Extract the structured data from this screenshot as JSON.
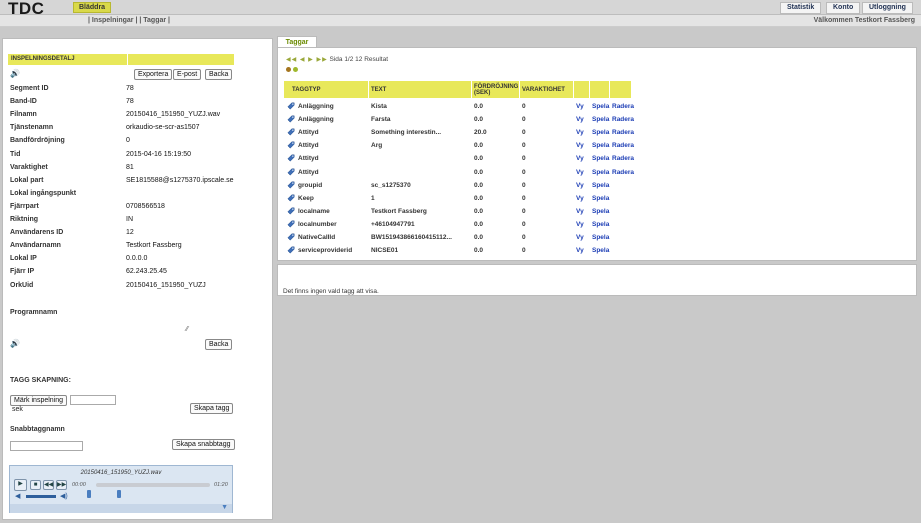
{
  "header": {
    "logo": "TDC",
    "active_nav": "Bläddra",
    "right_buttons": [
      "Statistik",
      "Konto",
      "Utloggning"
    ],
    "subnav": "| Inspelningar | | Taggar |",
    "welcome": "Välkommen Testkort Fassberg"
  },
  "detail": {
    "header": "INSPELNINGSDETALJ",
    "buttons": {
      "export": "Exportera",
      "email": "E-post",
      "back": "Backa"
    },
    "rows": [
      {
        "k": "Segment ID",
        "v": "78"
      },
      {
        "k": "Band-ID",
        "v": "78"
      },
      {
        "k": "Filnamn",
        "v": "20150416_151950_YUZJ.wav"
      },
      {
        "k": "Tjänstenamn",
        "v": "orkaudio-se-scr-as1507"
      },
      {
        "k": "Bandfördröjning",
        "v": "0"
      },
      {
        "k": "Tid",
        "v": "2015-04-16 15:19:50"
      },
      {
        "k": "Varaktighet",
        "v": "81"
      },
      {
        "k": "Lokal part",
        "v": "SE1815588@s1275370.ipscale.se"
      },
      {
        "k": "Lokal ingångspunkt",
        "v": ""
      },
      {
        "k": "Fjärrpart",
        "v": "0708566518"
      },
      {
        "k": "Riktning",
        "v": "IN"
      },
      {
        "k": "Användarens ID",
        "v": "12"
      },
      {
        "k": "Användarnamn",
        "v": "Testkort Fassberg"
      },
      {
        "k": "Lokal IP",
        "v": "0.0.0.0"
      },
      {
        "k": "Fjärr IP",
        "v": "62.243.25.45"
      },
      {
        "k": "OrkUid",
        "v": "20150416_151950_YUZJ"
      }
    ],
    "programnamn_label": "Programnamn",
    "back2": "Backa",
    "tag_creation_label": "TAGG SKAPNING:",
    "mark_btn": "Märk inspelning",
    "sek": "sek",
    "create_tag": "Skapa tagg",
    "quicktag_label": "Snabbtaggnamn",
    "create_quicktag": "Skapa snabbtagg"
  },
  "player": {
    "filename": "20150416_151950_YUZJ.wav",
    "time_current": "00:00",
    "time_total": "01:20"
  },
  "tags": {
    "tab_label": "Taggar",
    "pager_text": "Sida 1/2 12 Resultat",
    "columns": [
      "TAGGTYP",
      "TEXT",
      "FÖRDRÖJNING (SEK)",
      "VARAKTIGHET"
    ],
    "rows": [
      {
        "type": "Anläggning",
        "text": "Kista",
        "delay": "0.0",
        "dur": "0",
        "actions": [
          "Vy",
          "Spela",
          "Radera"
        ]
      },
      {
        "type": "Anläggning",
        "text": "Farsta",
        "delay": "0.0",
        "dur": "0",
        "actions": [
          "Vy",
          "Spela",
          "Radera"
        ]
      },
      {
        "type": "Attityd",
        "text": "Something interestin...",
        "delay": "20.0",
        "dur": "0",
        "actions": [
          "Vy",
          "Spela",
          "Radera"
        ]
      },
      {
        "type": "Attityd",
        "text": "Arg",
        "delay": "0.0",
        "dur": "0",
        "actions": [
          "Vy",
          "Spela",
          "Radera"
        ]
      },
      {
        "type": "Attityd",
        "text": "",
        "delay": "0.0",
        "dur": "0",
        "actions": [
          "Vy",
          "Spela",
          "Radera"
        ]
      },
      {
        "type": "Attityd",
        "text": "",
        "delay": "0.0",
        "dur": "0",
        "actions": [
          "Vy",
          "Spela",
          "Radera"
        ]
      },
      {
        "type": "groupid",
        "text": "sc_s1275370",
        "delay": "0.0",
        "dur": "0",
        "actions": [
          "Vy",
          "Spela"
        ]
      },
      {
        "type": "Keep",
        "text": "1",
        "delay": "0.0",
        "dur": "0",
        "actions": [
          "Vy",
          "Spela"
        ]
      },
      {
        "type": "localname",
        "text": "Testkort Fassberg",
        "delay": "0.0",
        "dur": "0",
        "actions": [
          "Vy",
          "Spela"
        ]
      },
      {
        "type": "localnumber",
        "text": "+46104947791",
        "delay": "0.0",
        "dur": "0",
        "actions": [
          "Vy",
          "Spela"
        ]
      },
      {
        "type": "NativeCallId",
        "text": "BW151943866160415112...",
        "delay": "0.0",
        "dur": "0",
        "actions": [
          "Vy",
          "Spela"
        ]
      },
      {
        "type": "serviceproviderid",
        "text": "NICSE01",
        "delay": "0.0",
        "dur": "0",
        "actions": [
          "Vy",
          "Spela"
        ]
      }
    ],
    "no_tag_msg": "Det finns ingen vald tagg att visa."
  }
}
